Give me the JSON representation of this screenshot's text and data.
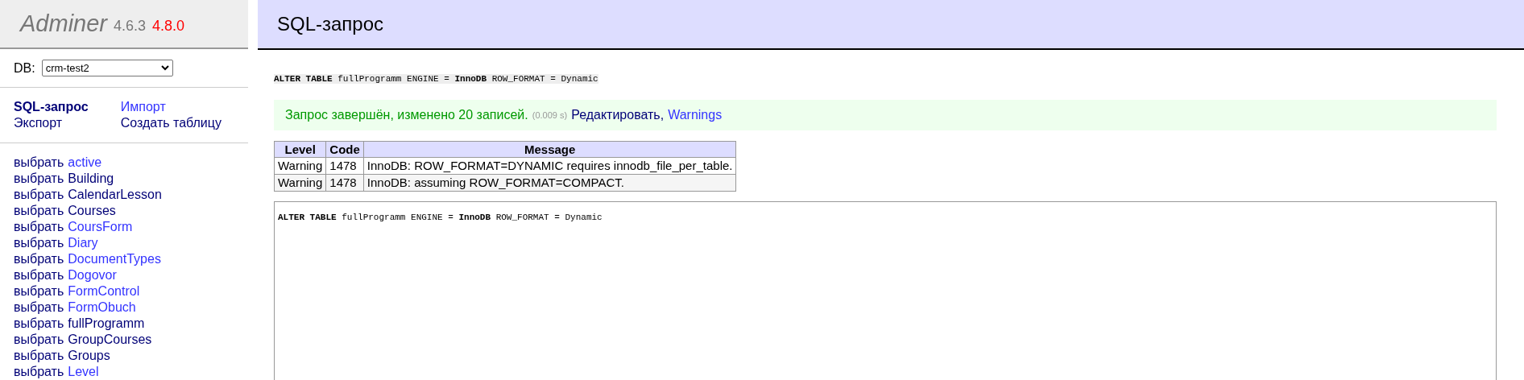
{
  "logo": {
    "name": "Adminer",
    "version": "4.6.3",
    "new_version": "4.8.0"
  },
  "db": {
    "label": "DB:",
    "value": "crm-test2"
  },
  "nav": [
    {
      "label": "SQL-запрос",
      "selected": true
    },
    {
      "label": "Импорт",
      "selected": false,
      "visited": false
    },
    {
      "label": "Экспорт",
      "selected": false,
      "visited": true
    },
    {
      "label": "Создать таблицу",
      "selected": false,
      "visited": true
    }
  ],
  "tables": [
    {
      "action": "выбрать",
      "name": "active",
      "visited": false
    },
    {
      "action": "выбрать",
      "name": "Building",
      "visited": true
    },
    {
      "action": "выбрать",
      "name": "CalendarLesson",
      "visited": true
    },
    {
      "action": "выбрать",
      "name": "Courses",
      "visited": true
    },
    {
      "action": "выбрать",
      "name": "CoursForm",
      "visited": false
    },
    {
      "action": "выбрать",
      "name": "Diary",
      "visited": false
    },
    {
      "action": "выбрать",
      "name": "DocumentTypes",
      "visited": false
    },
    {
      "action": "выбрать",
      "name": "Dogovor",
      "visited": false
    },
    {
      "action": "выбрать",
      "name": "FormControl",
      "visited": false
    },
    {
      "action": "выбрать",
      "name": "FormObuch",
      "visited": false
    },
    {
      "action": "выбрать",
      "name": "fullProgramm",
      "visited": true
    },
    {
      "action": "выбрать",
      "name": "GroupCourses",
      "visited": true
    },
    {
      "action": "выбрать",
      "name": "Groups",
      "visited": true
    },
    {
      "action": "выбрать",
      "name": "Level",
      "visited": false
    }
  ],
  "page_title": "SQL-запрос",
  "query": "**ALTER TABLE** fullProgramm ENGINE = **InnoDB** ROW_FORMAT = Dynamic",
  "message": {
    "text": "Запрос завершён, изменено 20 записей.",
    "time": "(0.009 s)",
    "links": [
      {
        "label": "Редактировать",
        "visited": true,
        "suffix": ","
      },
      {
        "label": "Warnings",
        "visited": false
      }
    ]
  },
  "warnings": {
    "columns": [
      "Level",
      "Code",
      "Message"
    ],
    "rows": [
      [
        "Warning",
        "1478",
        "InnoDB: ROW_FORMAT=DYNAMIC requires innodb_file_per_table."
      ],
      [
        "Warning",
        "1478",
        "InnoDB: assuming ROW_FORMAT=COMPACT."
      ]
    ]
  },
  "editor": {
    "value": "**ALTER TABLE** fullProgramm ENGINE = **InnoDB** ROW_FORMAT = Dynamic"
  }
}
